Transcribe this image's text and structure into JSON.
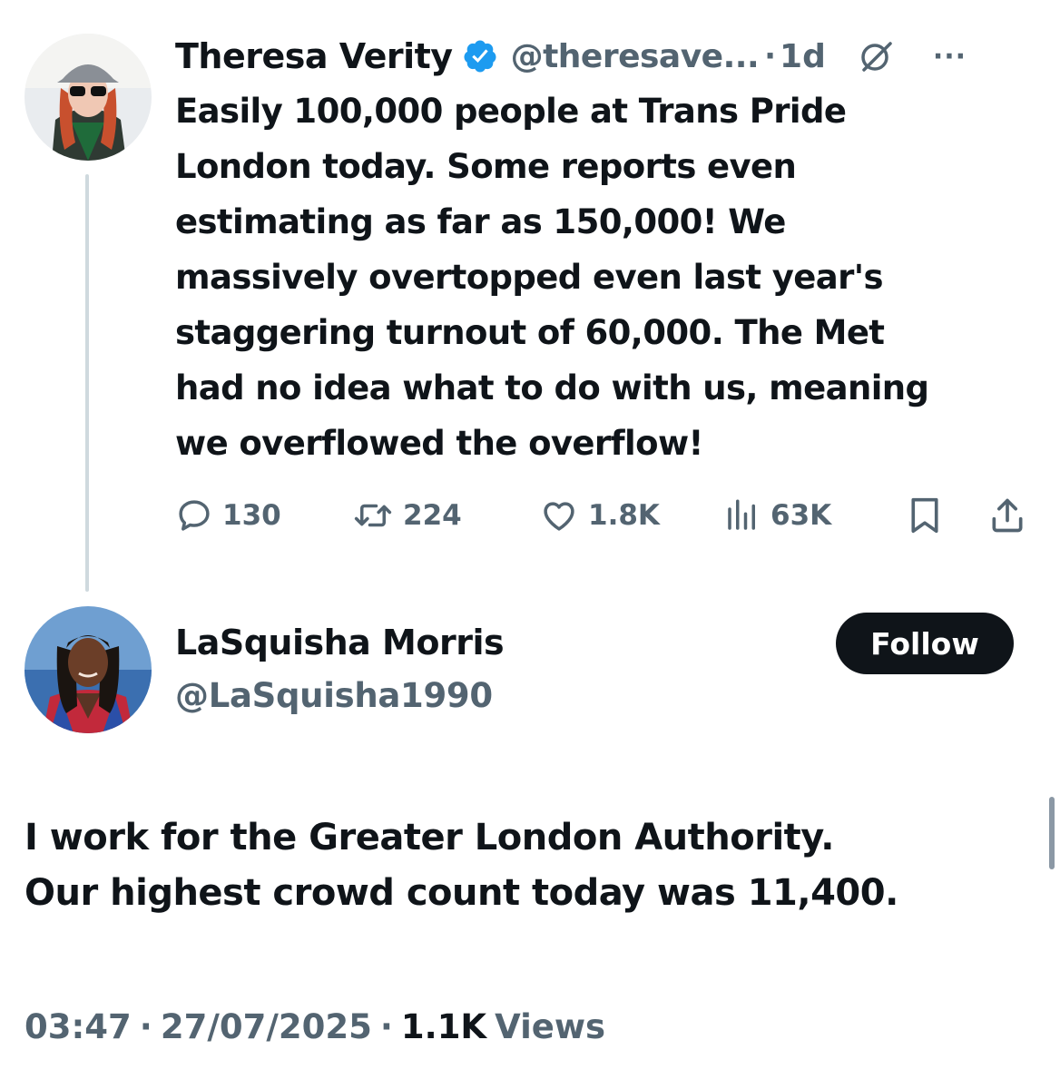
{
  "tweet": {
    "author_name": "Theresa Verity",
    "handle": "@theresave...",
    "separator": "·",
    "age": "1d",
    "more": "···",
    "text_lines": [
      "Easily 100,000 people at Trans Pride",
      "London today. Some reports even",
      "estimating as far as 150,000! We",
      "massively overtopped even last year's",
      "staggering turnout of 60,000. The Met",
      "had no idea what to do with us, meaning",
      "we overflowed the overflow!"
    ],
    "actions": {
      "replies": "130",
      "reposts": "224",
      "likes": "1.8K",
      "views": "63K"
    }
  },
  "reply": {
    "author_name": "LaSquisha Morris",
    "handle": "@LaSquisha1990",
    "follow_label": "Follow",
    "text_lines": [
      "I work for the Greater London Authority.",
      "Our highest crowd count today was 11,400."
    ],
    "time": "03:47",
    "date": "27/07/2025",
    "views_count": "1.1K",
    "views_label": "Views",
    "dot": "·"
  },
  "colors": {
    "text": "#0f1419",
    "muted": "#536471",
    "verified": "#1d9bf0",
    "follow_bg": "#0f1419",
    "thread_line": "#cfd9de"
  },
  "icons": [
    "verified-badge-icon",
    "grok-icon",
    "more-icon",
    "reply-icon",
    "repost-icon",
    "like-icon",
    "views-icon",
    "bookmark-icon",
    "share-icon"
  ]
}
